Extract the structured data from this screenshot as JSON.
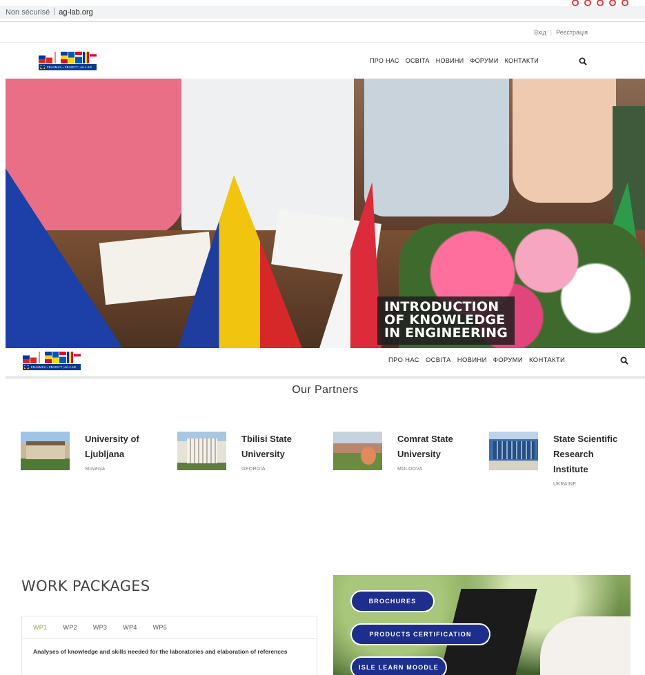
{
  "browser": {
    "security_label": "Non sécurisé",
    "domain": "ag-lab.org"
  },
  "util": {
    "login": "Вхід",
    "register": "Реєстрація"
  },
  "logo": {
    "text": "ERASMUS + PROJECT | AG-LAB"
  },
  "nav": {
    "items": [
      "ПРО НАС",
      "ОСВІТА",
      "НОВИНИ",
      "ФОРУМИ",
      "КОНТАКТИ"
    ]
  },
  "hero": {
    "caption_lines": [
      "INTRODUCTION",
      "OF KNOWLEDGE",
      "IN ENGINEERING"
    ]
  },
  "partners": {
    "title": "Our Partners",
    "items": [
      {
        "name_lines": [
          "University of",
          "Ljubljana"
        ],
        "country": "Slovenia"
      },
      {
        "name_lines": [
          "Tbilisi State",
          "University"
        ],
        "country": "GEORGIA"
      },
      {
        "name_lines": [
          "Comrat State",
          "University"
        ],
        "country": "MOLDOVA"
      },
      {
        "name_lines": [
          "State Scientific",
          "Research",
          "Institute"
        ],
        "country": "UKRAINE"
      }
    ]
  },
  "work_packages": {
    "title": "WORK PACKAGES",
    "tabs": [
      "WP1",
      "WP2",
      "WP3",
      "WP4",
      "WP5"
    ],
    "active_tab": "WP1",
    "text": "Analyses of knowledge and skills needed for the laboratories and elaboration of references"
  },
  "promo": {
    "buttons": [
      "BROCHURES",
      "PRODUCTS CERTIFICATION",
      "ISLE LEARN MOODLE"
    ]
  },
  "colors": {
    "accent_green": "#7cb342",
    "button_blue": "#1e2e8c",
    "caption_bg": "#1e1e1e"
  }
}
